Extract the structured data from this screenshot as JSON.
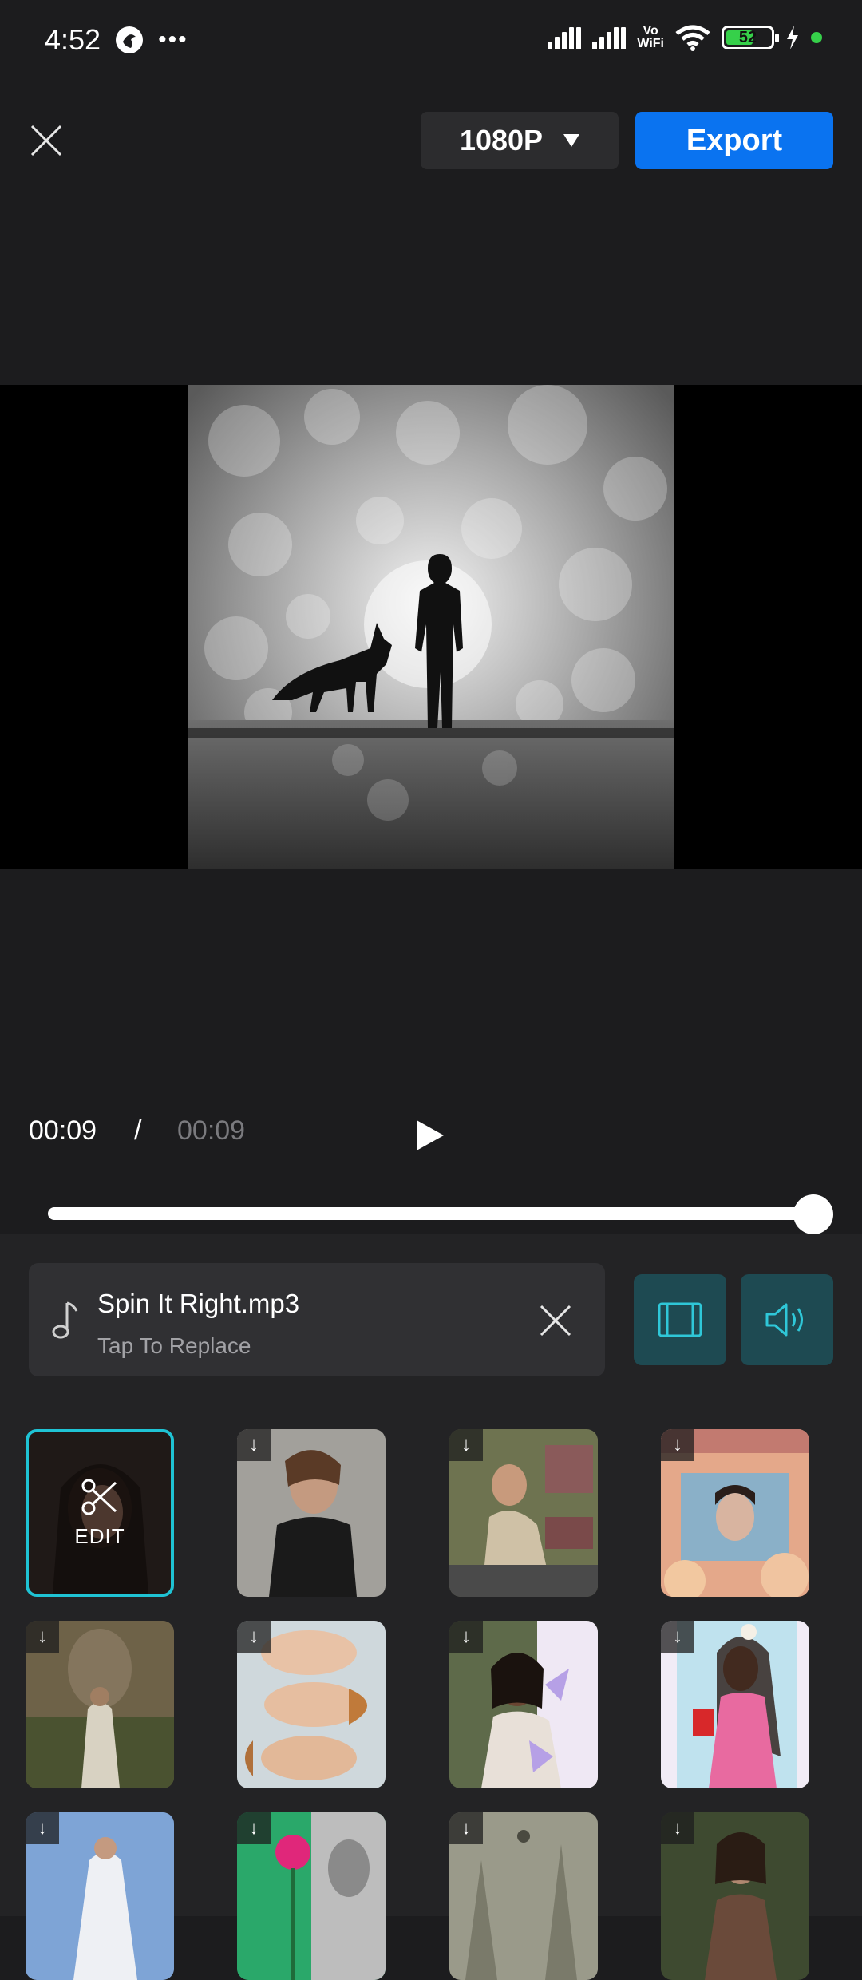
{
  "status": {
    "time": "4:52",
    "battery": "52",
    "vowifi_top": "Vo",
    "vowifi_bottom": "WiFi"
  },
  "toolbar": {
    "resolution": "1080P",
    "export_label": "Export"
  },
  "playback": {
    "current_time": "00:09",
    "separator": "/",
    "total_time": "00:09",
    "progress_percent": 100
  },
  "music": {
    "title": "Spin It Right.mp3",
    "subtitle": "Tap To Replace"
  },
  "templates": {
    "edit_label": "EDIT",
    "download_glyph": "↓"
  },
  "colors": {
    "accent_blue": "#0a73f0",
    "selection_cyan": "#1fc3d4",
    "tool_teal": "#1e4a52",
    "battery_green": "#36d04a"
  }
}
